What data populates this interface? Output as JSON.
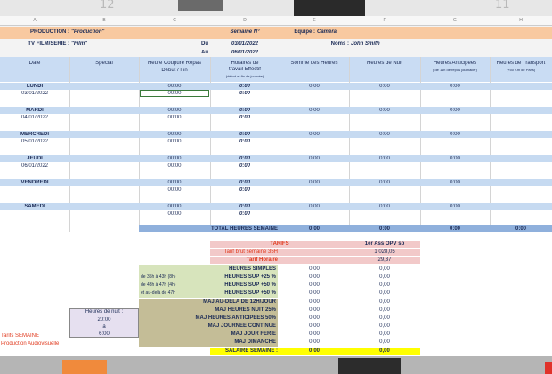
{
  "sheet": {
    "top_numbers": [
      "12",
      "11"
    ],
    "columns": [
      "A",
      "B",
      "C",
      "D",
      "E",
      "F",
      "G",
      "H"
    ]
  },
  "header": {
    "production_label": "PRODUCTION :",
    "production_value": "\"Production\"",
    "semaine_label": "Semaine N°",
    "equipe_label": "Equipe :",
    "equipe_value": "Caméra",
    "tv_label": "TV FILM/SERIE :",
    "tv_value": "\"Film\"",
    "du_label": "Du",
    "du_value": "03/01/2022",
    "noms_label": "Noms :",
    "noms_value": "John Smith",
    "au_label": "Au",
    "au_value": "06/01/2022"
  },
  "table": {
    "headers": {
      "date": "Date",
      "special": "Spécial",
      "coupure": "Heure Coupure Repas",
      "coupure2": "Début / Fin",
      "horaires": "Horaires de",
      "horaires2": "travail Effectif",
      "horaires_sub": "(début et fin de journée)",
      "somme": "Somme des Heures",
      "nuit": "Heures de Nuit",
      "anticipees": "Heures Anticipées",
      "anticipees_sub": "( de 11h de repos journalier)",
      "transport": "Heures de Transport",
      "transport_sub": "(+50 Km de Paris)"
    },
    "days": [
      {
        "name": "LUNDI",
        "date": "03/01/2022",
        "t1": "00:00",
        "t2": "00:00",
        "h1": "0:00",
        "h2": "0:00",
        "somme": "0:00",
        "nuit": "0:00",
        "antic": "0:00"
      },
      {
        "name": "MARDI",
        "date": "04/01/2022",
        "t1": "00:00",
        "t2": "00:00",
        "h1": "0:00",
        "h2": "0:00",
        "somme": "0:00",
        "nuit": "0:00",
        "antic": "0:00"
      },
      {
        "name": "MERCREDI",
        "date": "05/01/2022",
        "t1": "00:00",
        "t2": "00:00",
        "h1": "0:00",
        "h2": "0:00",
        "somme": "0:00",
        "nuit": "0:00",
        "antic": "0:00"
      },
      {
        "name": "JEUDI",
        "date": "06/01/2022",
        "t1": "00:00",
        "t2": "00:00",
        "h1": "0:00",
        "h2": "0:00",
        "somme": "0:00",
        "nuit": "0:00",
        "antic": "0:00"
      },
      {
        "name": "VENDREDI",
        "date": "",
        "t1": "00:00",
        "t2": "00:00",
        "h1": "0:00",
        "h2": "0:00",
        "somme": "0:00",
        "nuit": "0:00",
        "antic": "0:00"
      },
      {
        "name": "SAMEDI",
        "date": "",
        "t1": "00:00",
        "t2": "00:00",
        "h1": "0:00",
        "h2": "0:00",
        "somme": "0:00",
        "nuit": "0:00",
        "antic": "0:00"
      }
    ],
    "total_label": "TOTAL HEURES SEMAINE",
    "total_values": [
      "0:00",
      "0:00",
      "0:00",
      "0:00",
      "0:00"
    ]
  },
  "tarifs": {
    "title": "TARIFS",
    "role": "1er Ass OPV sp",
    "brut_label": "Tarif brut semaine 35H",
    "brut_value": "1 028,05",
    "horaire_label": "Tarif Horaire",
    "horaire_value": "29,37",
    "rows": [
      {
        "note": "",
        "label": "HEURES SIMPLES",
        "h": "0:00",
        "v": "0,00"
      },
      {
        "note": "de 35h à 43h (8h)",
        "label": "HEURES SUP +25 %",
        "h": "0:00",
        "v": "0,00"
      },
      {
        "note": "de 43h à 47h (4h)",
        "label": "HEURES SUP +50 %",
        "h": "0:00",
        "v": "0,00"
      },
      {
        "note": "et au-delà de 47h",
        "label": "HEURES SUP +50 %",
        "h": "0:00",
        "v": "0,00"
      },
      {
        "note": "",
        "label": "MAJ AU-DELA DE 12H/JOUR",
        "h": "0:00",
        "v": "0,00"
      },
      {
        "note": "",
        "label": "MAJ HEURES NUIT 25%",
        "h": "0:00",
        "v": "0,00"
      },
      {
        "note": "",
        "label": "MAJ HEURES ANTICIPEES 50%",
        "h": "0:00",
        "v": "0,00"
      },
      {
        "note": "",
        "label": "MAJ JOURNEE CONTINUE",
        "h": "0:00",
        "v": "0,00"
      },
      {
        "note": "",
        "label": "MAJ JOUR FERIE",
        "h": "0:00",
        "v": "0,00"
      },
      {
        "note": "",
        "label": "MAJ DIMANCHE",
        "h": "0:00",
        "v": "0,00"
      }
    ],
    "salaire_label": "SALAIRE SEMAINE :",
    "salaire_h": "0:00",
    "salaire_v": "0,00"
  },
  "nuit": {
    "label": "Heures de nuit :",
    "start": "20:00",
    "sep": "à",
    "end": "6:00"
  },
  "footer": {
    "tarifs_semaine": "Tarifs SEMAINE",
    "production_audio": "Production Audiovisuelle"
  },
  "colors": {
    "peach": "#f8c9a0",
    "blue_band": "#c6daf1",
    "green": "#d7e4bc",
    "khaki": "#c4bd97",
    "pink": "#f2c9c9",
    "yellow": "#ffff00",
    "red_text": "#e03a1e"
  }
}
